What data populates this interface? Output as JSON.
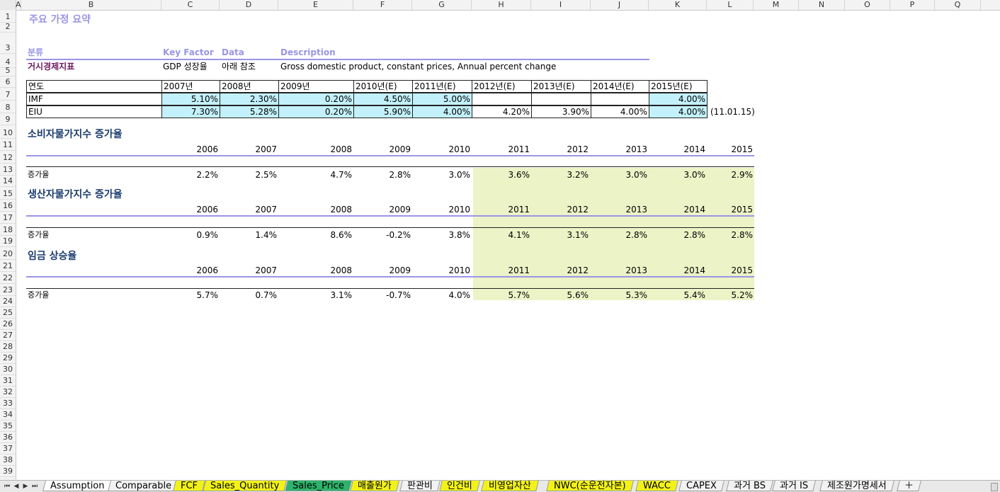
{
  "columns": [
    "A",
    "B",
    "C",
    "D",
    "E",
    "F",
    "G",
    "H",
    "I",
    "J",
    "K",
    "L",
    "M",
    "N",
    "O",
    "P",
    "Q"
  ],
  "row_numbers": [
    "1",
    "2",
    "3",
    "4",
    "5",
    "6",
    "7",
    "8",
    "9",
    "10",
    "11",
    "12",
    "13",
    "14",
    "15",
    "16",
    "17",
    "18",
    "19",
    "20",
    "21",
    "22",
    "23",
    "24",
    "25",
    "26",
    "27",
    "28",
    "29",
    "30",
    "31",
    "32",
    "33",
    "34",
    "35",
    "36",
    "37",
    "38",
    "39"
  ],
  "title": "주요 가정 요약",
  "headers": {
    "category": "분류",
    "key_factor": "Key Factor",
    "data": "Data",
    "description": "Description"
  },
  "row4": {
    "category": "거시경제지표",
    "key_factor": "GDP 성장율",
    "data": "아래 참조",
    "description": "Gross domestic product, constant prices, Annual percent change"
  },
  "gdp_table": {
    "header_label": "연도",
    "years": [
      "2007년",
      "2008년",
      "2009년",
      "2010년(E)",
      "2011년(E)",
      "2012년(E)",
      "2013년(E)",
      "2014년(E)",
      "2015년(E)"
    ],
    "imf_label": "IMF",
    "imf": [
      "5.10%",
      "2.30%",
      "0.20%",
      "4.50%",
      "5.00%",
      "",
      "",
      "",
      "4.00%"
    ],
    "eiu_label": "EIU",
    "eiu": [
      "7.30%",
      "5.28%",
      "0.20%",
      "5.90%",
      "4.00%",
      "4.20%",
      "3.90%",
      "4.00%",
      "4.00%"
    ],
    "eiu_note": "(11.01.15)"
  },
  "sections": [
    {
      "title": "소비자물가지수 증가율",
      "years": [
        "2006",
        "2007",
        "2008",
        "2009",
        "2010",
        "2011",
        "2012",
        "2013",
        "2014",
        "2015"
      ],
      "row_label": "증가율",
      "values": [
        "2.2%",
        "2.5%",
        "4.7%",
        "2.8%",
        "3.0%",
        "3.6%",
        "3.2%",
        "3.0%",
        "3.0%",
        "2.9%"
      ]
    },
    {
      "title": "생산자물가지수 증가율",
      "years": [
        "2006",
        "2007",
        "2008",
        "2009",
        "2010",
        "2011",
        "2012",
        "2013",
        "2014",
        "2015"
      ],
      "row_label": "증가율",
      "values": [
        "0.9%",
        "1.4%",
        "8.6%",
        "-0.2%",
        "3.8%",
        "4.1%",
        "3.1%",
        "2.8%",
        "2.8%",
        "2.8%"
      ]
    },
    {
      "title": "임금 상승율",
      "years": [
        "2006",
        "2007",
        "2008",
        "2009",
        "2010",
        "2011",
        "2012",
        "2013",
        "2014",
        "2015"
      ],
      "row_label": "증가율",
      "values": [
        "5.7%",
        "0.7%",
        "3.1%",
        "-0.7%",
        "4.0%",
        "5.7%",
        "5.6%",
        "5.3%",
        "5.4%",
        "5.2%"
      ]
    }
  ],
  "sheet_tabs": [
    {
      "label": "Assumption",
      "style": "active"
    },
    {
      "label": "Comparable",
      "style": "plain"
    },
    {
      "label": "FCF",
      "style": "yellow"
    },
    {
      "label": "Sales_Quantity",
      "style": "yellow"
    },
    {
      "label": "Sales_Price",
      "style": "green"
    },
    {
      "label": "매출원가",
      "style": "yellow"
    },
    {
      "label": "판관비",
      "style": "plain"
    },
    {
      "label": "인건비",
      "style": "yellow"
    },
    {
      "label": "비영업자산",
      "style": "yellow"
    },
    {
      "label": "NWC(순운전자본)",
      "style": "yellow"
    },
    {
      "label": "WACC",
      "style": "yellow"
    },
    {
      "label": "CAPEX",
      "style": "plain"
    },
    {
      "label": "과거 BS",
      "style": "plain"
    },
    {
      "label": "과거 IS",
      "style": "plain"
    },
    {
      "label": "제조원가명세서",
      "style": "plain"
    }
  ],
  "colors": {
    "accent": "#9a95e6",
    "forecast_fill": "#ecf3c6",
    "input_fill": "#c3f1fb",
    "heading": "#1b3d6e"
  }
}
